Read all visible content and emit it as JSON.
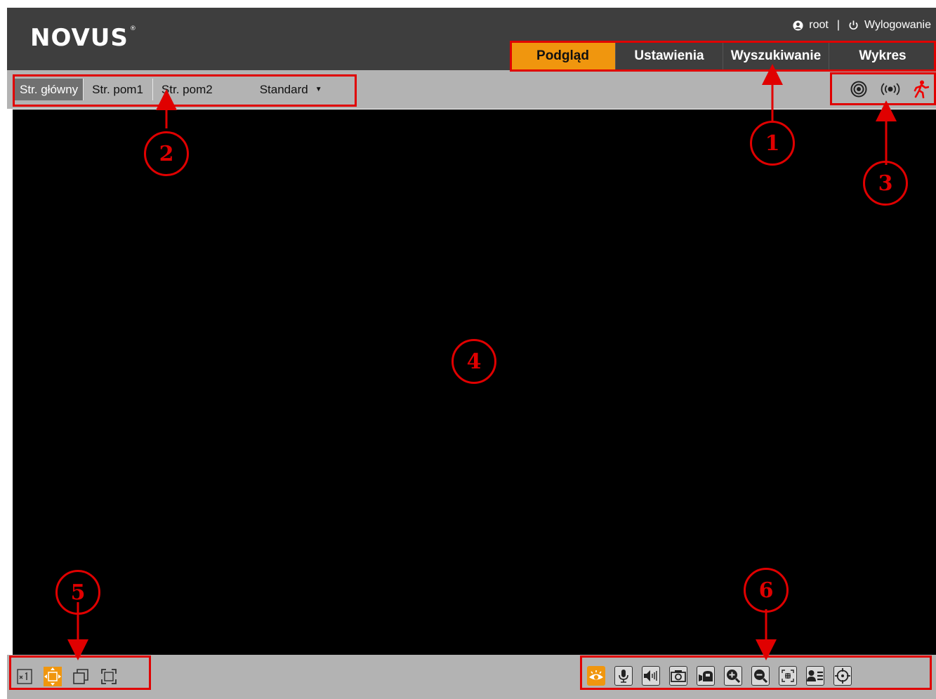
{
  "header": {
    "logo_text": "NOVUS",
    "logo_mark": "®",
    "user": "root",
    "separator": "|",
    "logout_label": "Wylogowanie"
  },
  "main_nav": {
    "tabs": [
      {
        "label": "Podgląd",
        "active": true
      },
      {
        "label": "Ustawienia",
        "active": false
      },
      {
        "label": "Wyszukiwanie",
        "active": false
      },
      {
        "label": "Wykres",
        "active": false
      }
    ]
  },
  "stream_bar": {
    "tabs": [
      {
        "label": "Str. główny",
        "active": true
      },
      {
        "label": "Str. pom1",
        "active": false
      },
      {
        "label": "Str. pom2",
        "active": false
      }
    ],
    "quality": "Standard",
    "status_icons": [
      "io-alarm-icon",
      "audio-alarm-icon",
      "motion-detection-icon"
    ]
  },
  "toolbar": {
    "view_controls": [
      "original-size-icon",
      "fit-window-icon",
      "window-mode-icon",
      "fullscreen-icon"
    ],
    "actions": [
      "live-view-icon",
      "microphone-icon",
      "speaker-icon",
      "snapshot-icon",
      "record-icon",
      "zoom-in-icon",
      "zoom-out-icon",
      "3d-zoom-icon",
      "face-detection-icon",
      "target-icon"
    ]
  },
  "annotations": [
    "1",
    "2",
    "3",
    "4",
    "5",
    "6"
  ],
  "colors": {
    "accent": "#f0960e",
    "header_bg": "#3e3e3e",
    "bar_bg": "#b3b3b3",
    "annotation": "#e00000"
  }
}
